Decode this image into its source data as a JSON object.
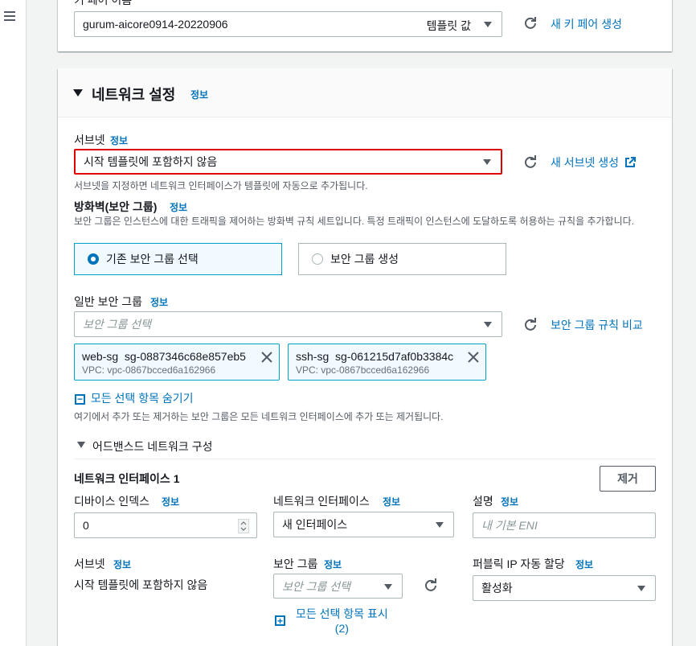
{
  "keypair": {
    "section_label_partial": "키 페어 이름",
    "value": "gurum-aicore0914-20220906",
    "template_badge": "템플릿 값",
    "new_link": "새 키 페어 생성"
  },
  "network": {
    "title": "네트워크 설정",
    "info": "정보",
    "subnet": {
      "label": "서브넷",
      "info": "정보",
      "value": "시작 템플릿에 포함하지 않음",
      "help": "서브넷을 지정하면 네트워크 인터페이스가 템플릿에 자동으로 추가됩니다.",
      "new_link": "새 서브넷 생성"
    },
    "firewall": {
      "label": "방화벽(보안 그룹)",
      "info": "정보",
      "desc": "보안 그룹은 인스턴스에 대한 트래픽을 제어하는 방화벽 규칙 세트입니다. 특정 트래픽이 인스턴스에 도달하도록 허용하는 규칙을 추가합니다.",
      "option_existing": "기존 보안 그룹 선택",
      "option_create": "보안 그룹 생성"
    },
    "common_sg": {
      "label": "일반 보안 그룹",
      "info": "정보",
      "placeholder": "보안 그룹 선택",
      "compare_link": "보안 그룹 규칙 비교",
      "tokens": [
        {
          "name": "web-sg",
          "id": "sg-0887346c68e857eb5",
          "vpc": "VPC: vpc-0867bcced6a162966"
        },
        {
          "name": "ssh-sg",
          "id": "sg-061215d7af0b3384c",
          "vpc": "VPC: vpc-0867bcced6a162966"
        }
      ],
      "hide_all": "모든 선택 항목 숨기기",
      "footer": "여기에서 추가 또는 제거하는 보안 그룹은 모든 네트워크 인터페이스에 추가 또는 제거됩니다."
    },
    "advanced": {
      "title": "어드밴스드 네트워크 구성",
      "eni_title": "네트워크 인터페이스 1",
      "remove_button": "제거",
      "device_index_label": "디바이스 인덱스",
      "device_index_value": "0",
      "ni_label": "네트워크 인터페이스",
      "ni_value": "새 인터페이스",
      "desc_label": "설명",
      "desc_placeholder": "내 기본 ENI",
      "subnet_label": "서브넷",
      "subnet_value": "시작 템플릿에 포함하지 않음",
      "sg_label": "보안 그룹",
      "sg_placeholder": "보안 그룹 선택",
      "show_all_line1": "모든 선택 항목 표시",
      "show_all_line2": "(2)",
      "public_ip_label": "퍼블릭 IP 자동 할당",
      "public_ip_value": "활성화",
      "info": "정보"
    }
  },
  "colors": {
    "link": "#0073bb",
    "highlight_border": "#e00000",
    "selected_radio": "#0073bb"
  }
}
